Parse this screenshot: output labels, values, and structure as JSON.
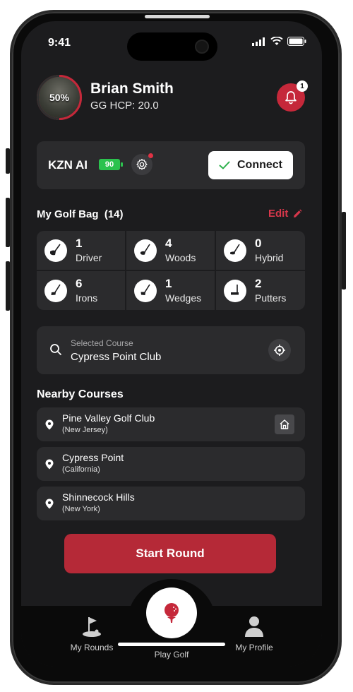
{
  "status": {
    "time": "9:41"
  },
  "profile": {
    "name": "Brian Smith",
    "handicap": "GG HCP: 20.0",
    "progress_label": "50%",
    "progress": 0.5,
    "notifications": "1"
  },
  "device": {
    "name": "KZN AI",
    "battery": "90",
    "connect_label": "Connect"
  },
  "bag": {
    "title": "My Golf Bag  (14)",
    "edit_label": "Edit",
    "clubs": [
      {
        "count": "1",
        "name": "Driver"
      },
      {
        "count": "4",
        "name": "Woods"
      },
      {
        "count": "0",
        "name": "Hybrid"
      },
      {
        "count": "6",
        "name": "Irons"
      },
      {
        "count": "1",
        "name": "Wedges"
      },
      {
        "count": "2",
        "name": "Putters"
      }
    ]
  },
  "course": {
    "label": "Selected Course",
    "value": "Cypress Point Club"
  },
  "nearby": {
    "title": "Nearby Courses",
    "items": [
      {
        "name": "Pine Valley Golf Club",
        "region": "(New Jersey)"
      },
      {
        "name": "Cypress Point",
        "region": "(California)"
      },
      {
        "name": "Shinnecock Hills",
        "region": "(New York)"
      }
    ]
  },
  "start_label": "Start Round",
  "tabs": [
    {
      "label": "My Rounds"
    },
    {
      "label": "Play Golf"
    },
    {
      "label": "My Profile"
    }
  ],
  "colors": {
    "accent": "#c5283a",
    "battery": "#2bc24e",
    "card": "#2b2b2d",
    "background": "#1c1c1e"
  }
}
